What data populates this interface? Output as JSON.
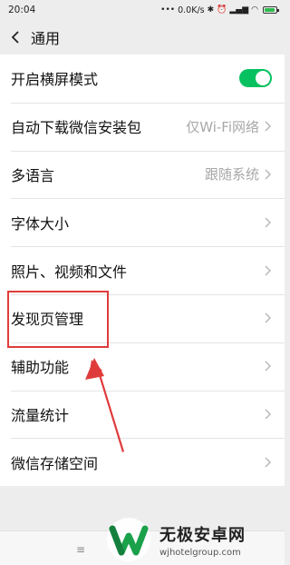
{
  "status_bar": {
    "time": "20:04",
    "network_speed": "0.0K/s",
    "icons": [
      "dots-icon",
      "bluetooth-icon",
      "alarm-icon",
      "signal-icon",
      "wifi-icon",
      "battery-icon"
    ]
  },
  "nav": {
    "back_icon": "chevron-left-icon",
    "title": "通用"
  },
  "settings": {
    "items": [
      {
        "label": "开启横屏模式",
        "toggle_on": true
      },
      {
        "label": "自动下载微信安装包",
        "value": "仅Wi-Fi网络"
      },
      {
        "label": "多语言",
        "value": "跟随系统"
      },
      {
        "label": "字体大小"
      },
      {
        "label": "照片、视频和文件"
      },
      {
        "label": "发现页管理",
        "highlighted": true
      },
      {
        "label": "辅助功能"
      },
      {
        "label": "流量统计"
      },
      {
        "label": "微信存储空间"
      }
    ]
  },
  "bottom_bar": {
    "menu_glyph": "≡"
  },
  "watermark": {
    "title": "无极安卓网",
    "url": "wjhotelgroup.com"
  },
  "colors": {
    "toggle_on": "#07c160",
    "highlight_box": "#e03b3b",
    "arrow": "#e03b3b",
    "background": "#ededed"
  }
}
